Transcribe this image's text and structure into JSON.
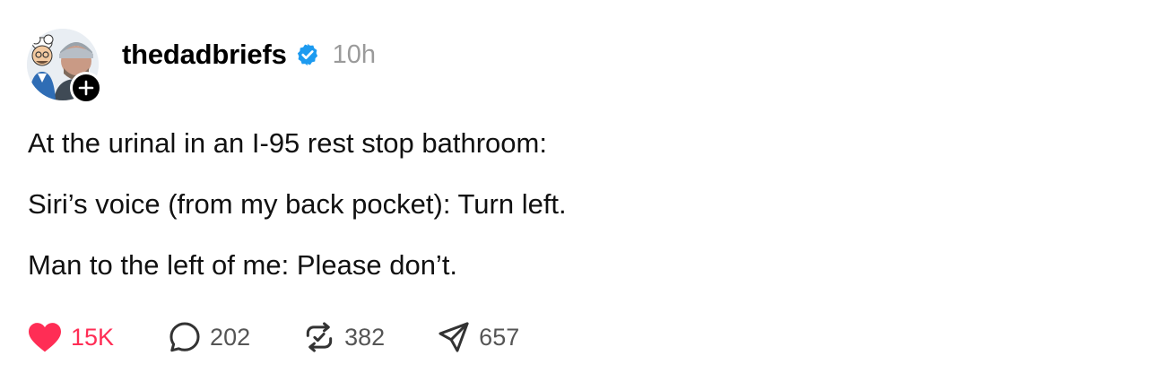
{
  "post": {
    "author": {
      "username": "thedadbriefs",
      "verified": true,
      "avatar_icon": "avatar-illustrated-dad-and-photo",
      "follow_badge_icon": "plus-icon"
    },
    "time_ago": "10h",
    "paragraphs": [
      "At the urinal in an I-95 rest stop bathroom:",
      "Siri’s voice (from my back pocket): Turn left.",
      "Man to the left of me: Please don’t."
    ]
  },
  "actions": {
    "like": {
      "icon": "heart-icon",
      "count": "15K",
      "active": true
    },
    "reply": {
      "icon": "comment-icon",
      "count": "202"
    },
    "repost": {
      "icon": "repost-icon",
      "count": "382"
    },
    "share": {
      "icon": "send-icon",
      "count": "657"
    }
  },
  "colors": {
    "like_active": "#ff2d55",
    "verified_blue": "#1d9bf0",
    "muted": "#9a9a9a",
    "text": "#111111"
  }
}
